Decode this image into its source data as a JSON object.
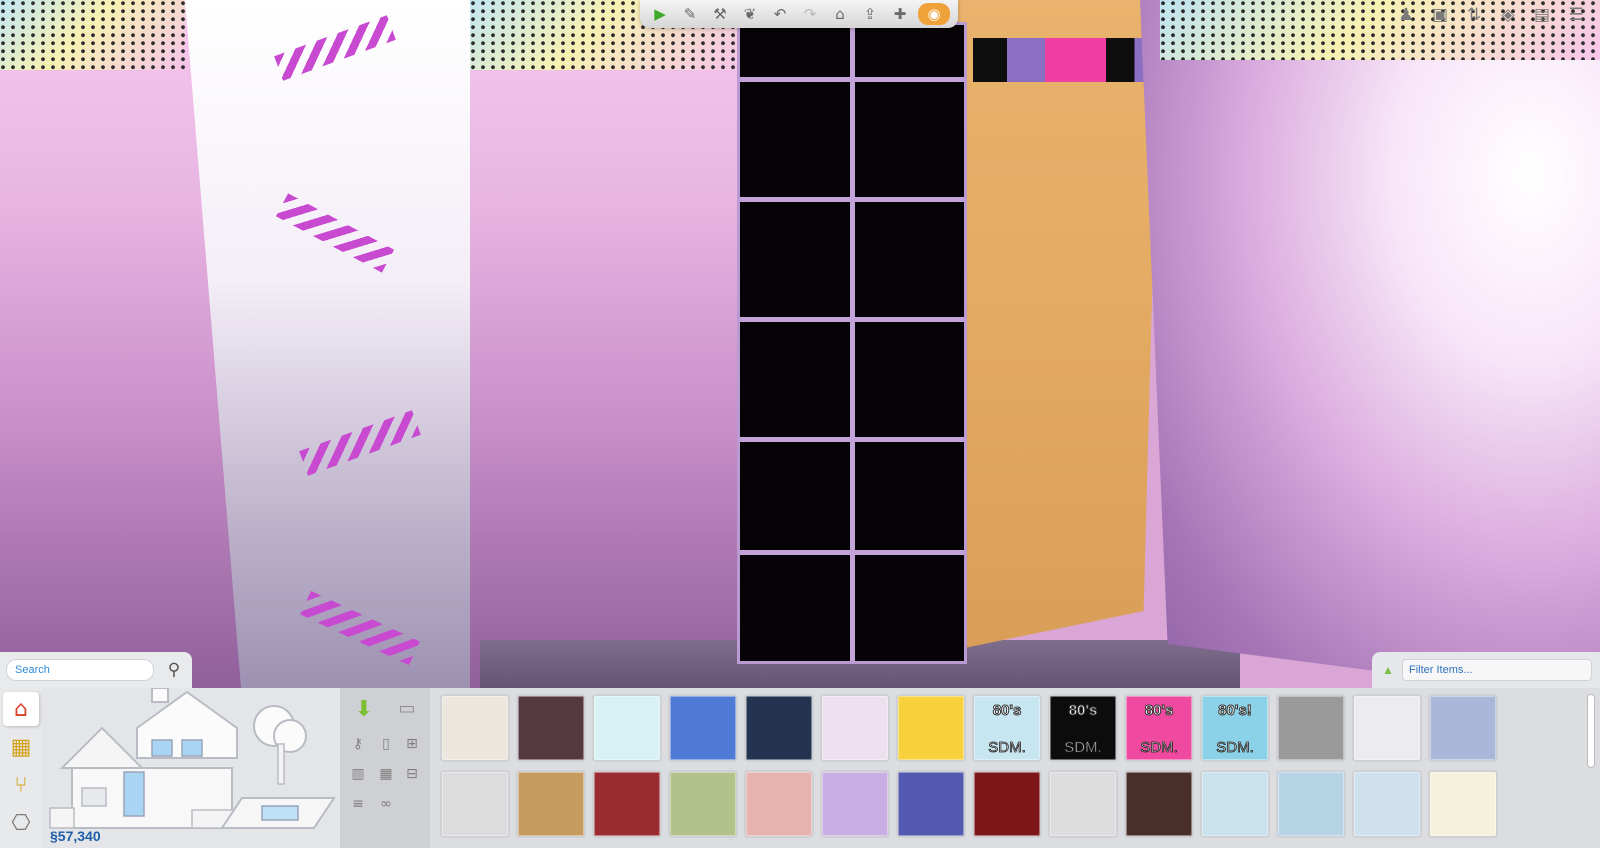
{
  "toolbar": {
    "buttons": [
      {
        "name": "select-tool",
        "icon": "▶",
        "style": "green"
      },
      {
        "name": "eyedropper-tool",
        "icon": "✎",
        "style": ""
      },
      {
        "name": "sledgehammer-tool",
        "icon": "⚒",
        "style": ""
      },
      {
        "name": "design-tool",
        "icon": "❦",
        "style": ""
      },
      {
        "name": "undo",
        "icon": "↶",
        "style": ""
      },
      {
        "name": "redo",
        "icon": "↷",
        "style": "disabled"
      },
      {
        "name": "home",
        "icon": "⌂",
        "style": ""
      },
      {
        "name": "move-lot",
        "icon": "⇪",
        "style": ""
      },
      {
        "name": "move-objects",
        "icon": "✚",
        "style": ""
      },
      {
        "name": "camera",
        "icon": "◉",
        "style": "camera"
      }
    ],
    "right_icons": [
      {
        "name": "sim-icon",
        "icon": "♟"
      },
      {
        "name": "gallery-icon",
        "icon": "▣"
      },
      {
        "name": "floor-up-icon",
        "icon": "⇅"
      },
      {
        "name": "walls-icon",
        "icon": "◈"
      },
      {
        "name": "camera-icon",
        "icon": "▤"
      },
      {
        "name": "options-icon",
        "icon": "☰"
      }
    ]
  },
  "search": {
    "placeholder": "Search",
    "search_icon": "⚲"
  },
  "filter": {
    "placeholder": "Filter Items...",
    "arrow_icon": "▲"
  },
  "modes": [
    {
      "name": "build-mode",
      "icon": "⌂",
      "color": "#d9442b",
      "active": true
    },
    {
      "name": "room-mode",
      "icon": "▦",
      "color": "#d3a21c",
      "active": false
    },
    {
      "name": "buy-mode",
      "icon": "⑂",
      "color": "#d3a21c",
      "active": false
    },
    {
      "name": "library-mode",
      "icon": "⎔",
      "color": "#7b7b7b",
      "active": false
    }
  ],
  "funds": "§57,340",
  "tools": {
    "wall": "⬇",
    "floor": "▭",
    "grid": [
      "⚷",
      "▯",
      "⊞",
      "▥",
      "▦",
      "⊟",
      "≡",
      "∞"
    ]
  },
  "catalog": {
    "rows": [
      [
        {
          "id": "cream-paper",
          "fill": "#ece6df"
        },
        {
          "id": "plum",
          "fill": "#563840"
        },
        {
          "id": "ice-blue",
          "fill": "#d8f1f3"
        },
        {
          "id": "cornflower",
          "fill": "#4f7bd6"
        },
        {
          "id": "navy",
          "fill": "#233350"
        },
        {
          "id": "lilac-stripe",
          "fill": "#ede0ef"
        },
        {
          "id": "sunflower",
          "fill": "#f7d23c"
        },
        {
          "id": "sdm-80s-pastel",
          "fill": "#c7e6f1",
          "title": "80's",
          "subtitle": "SDM."
        },
        {
          "id": "sdm-80s-black",
          "fill": "#0c0c0c",
          "title": "80's",
          "subtitle": "SDM."
        },
        {
          "id": "sdm-80s-pink",
          "fill": "#ef4aa0",
          "title": "80's",
          "subtitle": "SDM."
        },
        {
          "id": "sdm-80s-rainbow",
          "fill": "#8bd2e8",
          "title": "80's!",
          "subtitle": "SDM."
        },
        {
          "id": "gray-tile",
          "fill": "#9a9a9a"
        },
        {
          "id": "offwhite",
          "fill": "#ececee"
        },
        {
          "id": "powder-blue",
          "fill": "#a9b7d9"
        }
      ],
      [
        {
          "id": "pale-gray",
          "fill": "#dcdcdc"
        },
        {
          "id": "tan-wood",
          "fill": "#c69b5f"
        },
        {
          "id": "crimson",
          "fill": "#9a2b30"
        },
        {
          "id": "sage",
          "fill": "#b3c28a"
        },
        {
          "id": "blush",
          "fill": "#e6b3ae"
        },
        {
          "id": "lavender",
          "fill": "#c9aee3"
        },
        {
          "id": "indigo",
          "fill": "#5358b0"
        },
        {
          "id": "deep-red",
          "fill": "#7c1619"
        },
        {
          "id": "gray-trim",
          "fill": "#dddddd"
        },
        {
          "id": "chocolate",
          "fill": "#4a2f28"
        },
        {
          "id": "sky-speckle",
          "fill": "#c9e2ee"
        },
        {
          "id": "sky-trim",
          "fill": "#b7d3e6"
        },
        {
          "id": "lace-blue",
          "fill": "#cfe1ef"
        },
        {
          "id": "cream-border",
          "fill": "#f6f1dc"
        }
      ]
    ]
  }
}
